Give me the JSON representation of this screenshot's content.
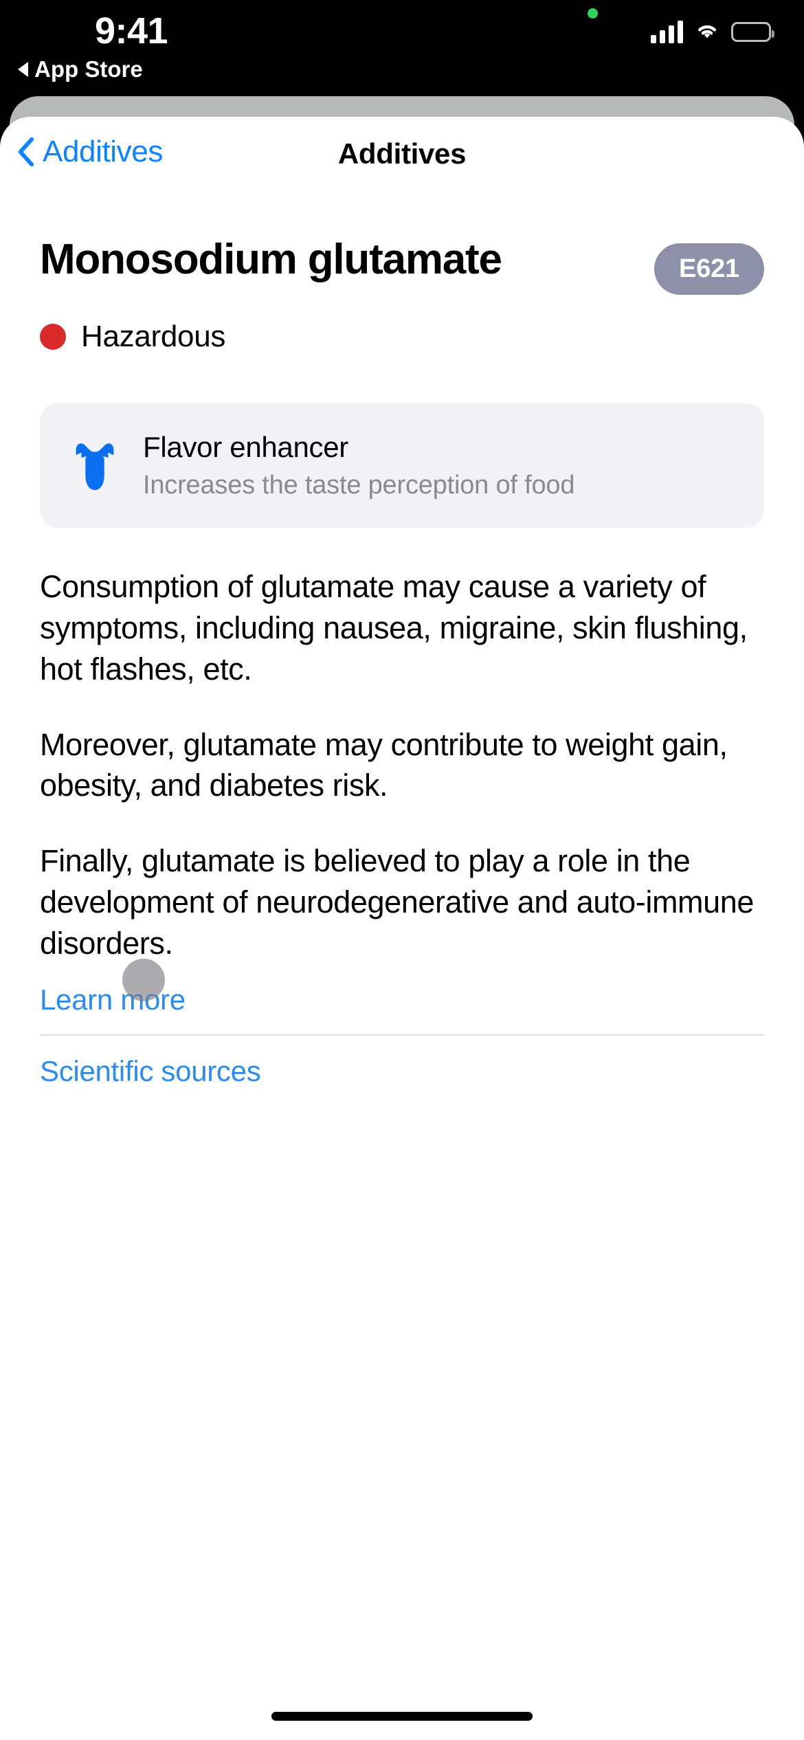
{
  "status_bar": {
    "time": "9:41",
    "back_to_app_label": "App Store",
    "icons": {
      "back_triangle": "back-triangle-icon",
      "recording_dot": "recording-indicator-dot",
      "signal": "cellular-signal-icon",
      "wifi": "wifi-icon",
      "battery": "battery-icon"
    },
    "colors": {
      "recording_green": "#30d158"
    }
  },
  "navbar": {
    "back_label": "Additives",
    "title": "Additives",
    "back_icon": "chevron-left-icon",
    "tint_color": "#0a84ff"
  },
  "additive": {
    "name": "Monosodium glutamate",
    "e_number": "E621",
    "e_number_badge_color": "#8e8fa9",
    "hazard_label": "Hazardous",
    "hazard_color": "#d92b2b"
  },
  "function_card": {
    "icon": "tongue-icon",
    "icon_color": "#0a6ff0",
    "title": "Flavor enhancer",
    "subtitle": "Increases the taste perception of food",
    "background": "#f2f2f6"
  },
  "description": {
    "paragraphs": [
      "Consumption of glutamate may cause a variety of symptoms, including nausea, migraine, skin flushing, hot flashes, etc.",
      "Moreover, glutamate may contribute to weight gain, obesity, and diabetes risk.",
      "Finally, glutamate is believed to play a role in the development of neurodegenerative and auto-immune disorders."
    ]
  },
  "links": {
    "learn_more": "Learn more",
    "scientific_sources": "Scientific sources",
    "link_color": "#2b8bf2"
  }
}
